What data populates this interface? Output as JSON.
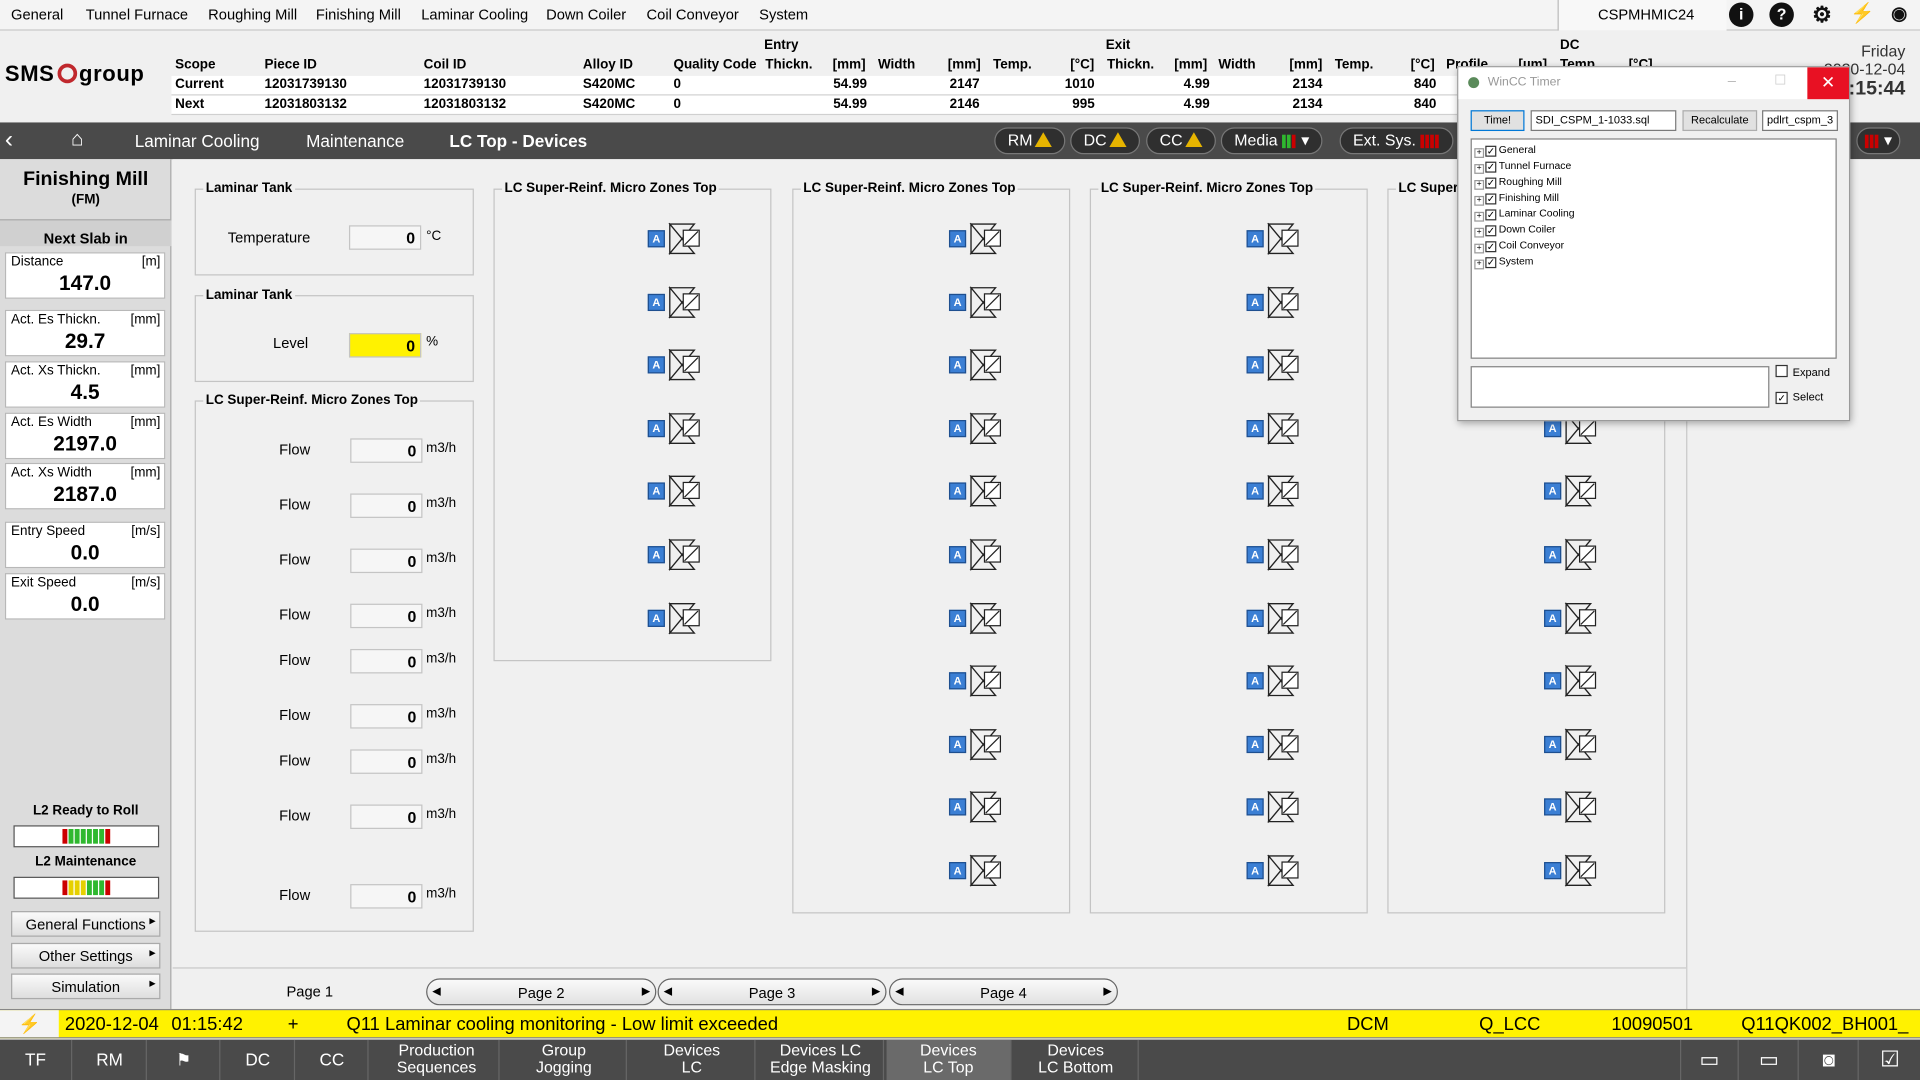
{
  "top_menu": {
    "items": [
      "General",
      "Tunnel Furnace",
      "Roughing Mill",
      "Finishing Mill",
      "Laminar Cooling",
      "Down Coiler",
      "Coil Conveyor",
      "System"
    ],
    "host": "CSPMHMIC24"
  },
  "logo": {
    "text1": "SMS",
    "text2": "group"
  },
  "scope_table": {
    "group_entry": "Entry",
    "group_exit": "Exit",
    "group_dc": "DC",
    "headers": [
      "Scope",
      "Piece ID",
      "Coil ID",
      "Alloy ID",
      "Quality Code",
      "Thickn.",
      "[mm]",
      "Width",
      "[mm]",
      "Temp.",
      "[°C]",
      "Thickn.",
      "[mm]",
      "Width",
      "[mm]",
      "Temp.",
      "[°C]",
      "Profile",
      "[µm]",
      "Temp.",
      "[°C]"
    ],
    "rows": [
      {
        "scope": "Current",
        "piece_id": "12031739130",
        "coil_id": "12031739130",
        "alloy_id": "S420MC",
        "quality": "0",
        "entry_thick": "54.99",
        "entry_width": "2147",
        "entry_temp": "1010",
        "exit_thick": "4.99",
        "exit_width": "2134",
        "exit_temp": "840"
      },
      {
        "scope": "Next",
        "piece_id": "12031803132",
        "coil_id": "12031803132",
        "alloy_id": "S420MC",
        "quality": "0",
        "entry_thick": "54.99",
        "entry_width": "2146",
        "entry_temp": "995",
        "exit_thick": "4.99",
        "exit_width": "2134",
        "exit_temp": "840"
      }
    ]
  },
  "datetime": {
    "weekday": "Friday",
    "date": "2020-12-04",
    "time": "01:15:44"
  },
  "navbar": {
    "crumbs": [
      "Laminar Cooling",
      "Maintenance",
      "LC Top - Devices"
    ],
    "pills": [
      "RM",
      "DC",
      "CC",
      "Media",
      "Ext. Sys."
    ]
  },
  "left_panel": {
    "title": "Finishing Mill",
    "subtitle": "(FM)",
    "next_slab_label": "Next Slab in",
    "values": [
      {
        "name": "Distance",
        "unit": "[m]",
        "value": "147.0"
      },
      {
        "name": "Act. Es Thickn.",
        "unit": "[mm]",
        "value": "29.7"
      },
      {
        "name": "Act. Xs Thickn.",
        "unit": "[mm]",
        "value": "4.5"
      },
      {
        "name": "Act. Es Width",
        "unit": "[mm]",
        "value": "2197.0"
      },
      {
        "name": "Act. Xs Width",
        "unit": "[mm]",
        "value": "2187.0"
      },
      {
        "name": "Entry Speed",
        "unit": "[m/s]",
        "value": "0.0"
      },
      {
        "name": "Exit Speed",
        "unit": "[m/s]",
        "value": "0.0"
      }
    ],
    "l2_ready_label": "L2 Ready to Roll",
    "l2_maint_label": "L2 Maintenance",
    "buttons": [
      "General Functions",
      "Other Settings",
      "Simulation"
    ]
  },
  "main": {
    "tank1": {
      "title": "Laminar Tank",
      "label": "Temperature",
      "value": "0",
      "unit": "°C"
    },
    "tank2": {
      "title": "Laminar Tank",
      "label": "Level",
      "value": "0",
      "unit": "%"
    },
    "flow_group": {
      "title": "LC Super-Reinf. Micro Zones Top",
      "label": "Flow",
      "unit": "m3/h",
      "values": [
        "0",
        "0",
        "0",
        "0",
        "0",
        "0",
        "0",
        "0",
        "0"
      ]
    },
    "zone_title": "LC Super-Reinf. Micro Zones Top",
    "zone_title_cut": "LC Super",
    "device_letter": "A"
  },
  "pages": [
    "Page 1",
    "Page 2",
    "Page 3",
    "Page 4"
  ],
  "alarm": {
    "date": "2020-12-04",
    "time": "01:15:42",
    "flag": "+",
    "message": "Q11 Laminar cooling monitoring - Low limit exceeded",
    "source": "DCM",
    "area": "Q_LCC",
    "number": "10090501",
    "tag": "Q11QK002_BH001_"
  },
  "bottom_tabs": {
    "simple": [
      "TF",
      "RM",
      "DC",
      "CC"
    ],
    "two_line": [
      [
        "Production",
        "Sequences"
      ],
      [
        "Group",
        "Jogging"
      ],
      [
        "Devices",
        "LC"
      ],
      [
        "Devices LC",
        "Edge Masking"
      ],
      [
        "Devices",
        "LC Top"
      ],
      [
        "Devices",
        "LC Bottom"
      ]
    ]
  },
  "popup": {
    "title": "WinCC Timer",
    "time_btn": "Time!",
    "file": "SDI_CSPM_1-1033.sql",
    "recalc_btn": "Recalculate",
    "db": "pdlrt_cspm_3",
    "tree": [
      "General",
      "Tunnel Furnace",
      "Roughing Mill",
      "Finishing Mill",
      "Laminar Cooling",
      "Down Coiler",
      "Coil Conveyor",
      "System"
    ],
    "expand_label": "Expand",
    "select_label": "Select"
  },
  "colors": {
    "accent_yellow": "#fff200",
    "nav_dark": "#4a4a4a",
    "device_blue": "#3b7fd4",
    "close_red": "#e81123"
  }
}
